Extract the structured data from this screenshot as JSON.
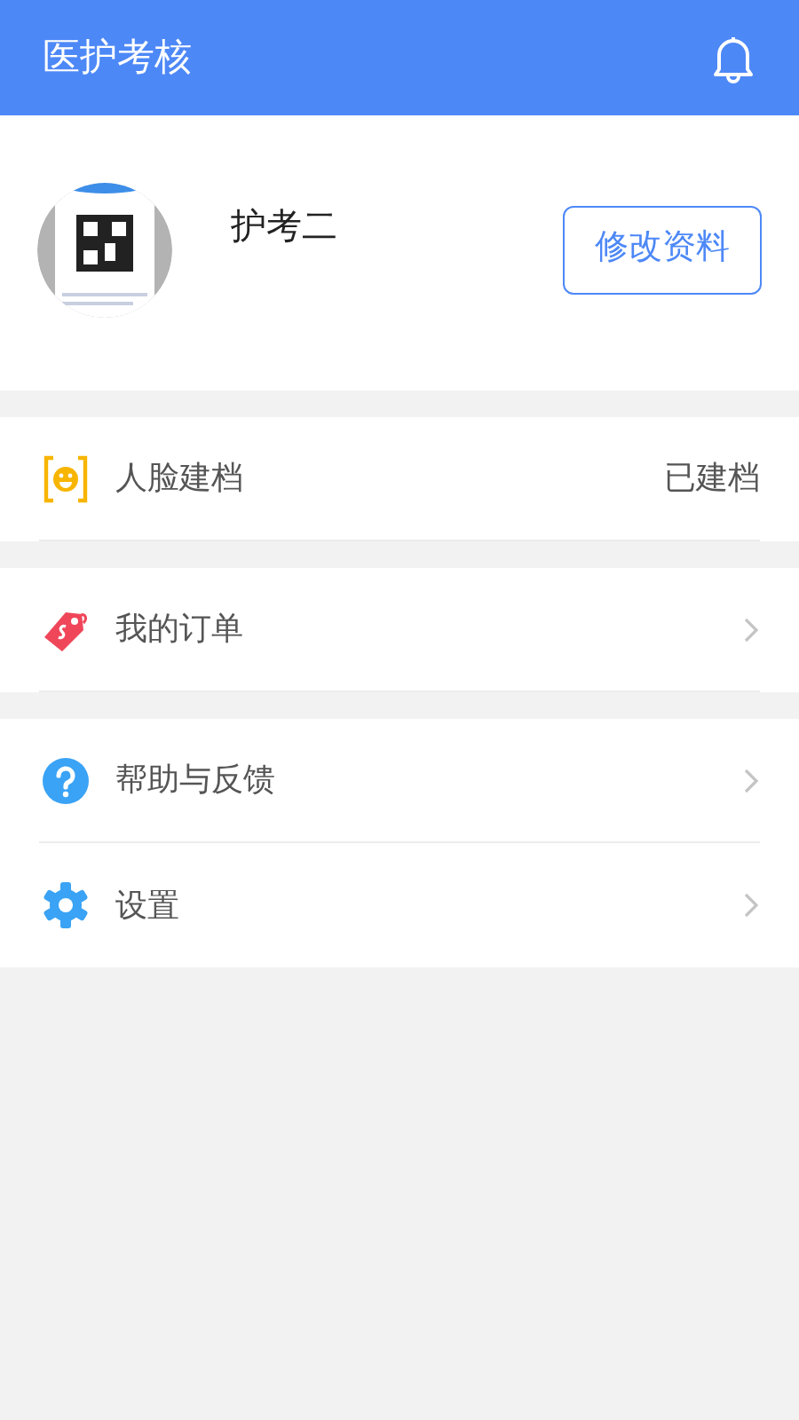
{
  "header": {
    "title": "医护考核"
  },
  "profile": {
    "name": "护考二",
    "edit_button": "修改资料"
  },
  "menu_groups": [
    {
      "items": [
        {
          "kind": "face",
          "label": "人脸建档",
          "value": "已建档"
        }
      ]
    },
    {
      "items": [
        {
          "kind": "order",
          "label": "我的订单"
        }
      ]
    },
    {
      "items": [
        {
          "kind": "help",
          "label": "帮助与反馈"
        },
        {
          "kind": "settings",
          "label": "设置"
        }
      ]
    }
  ]
}
